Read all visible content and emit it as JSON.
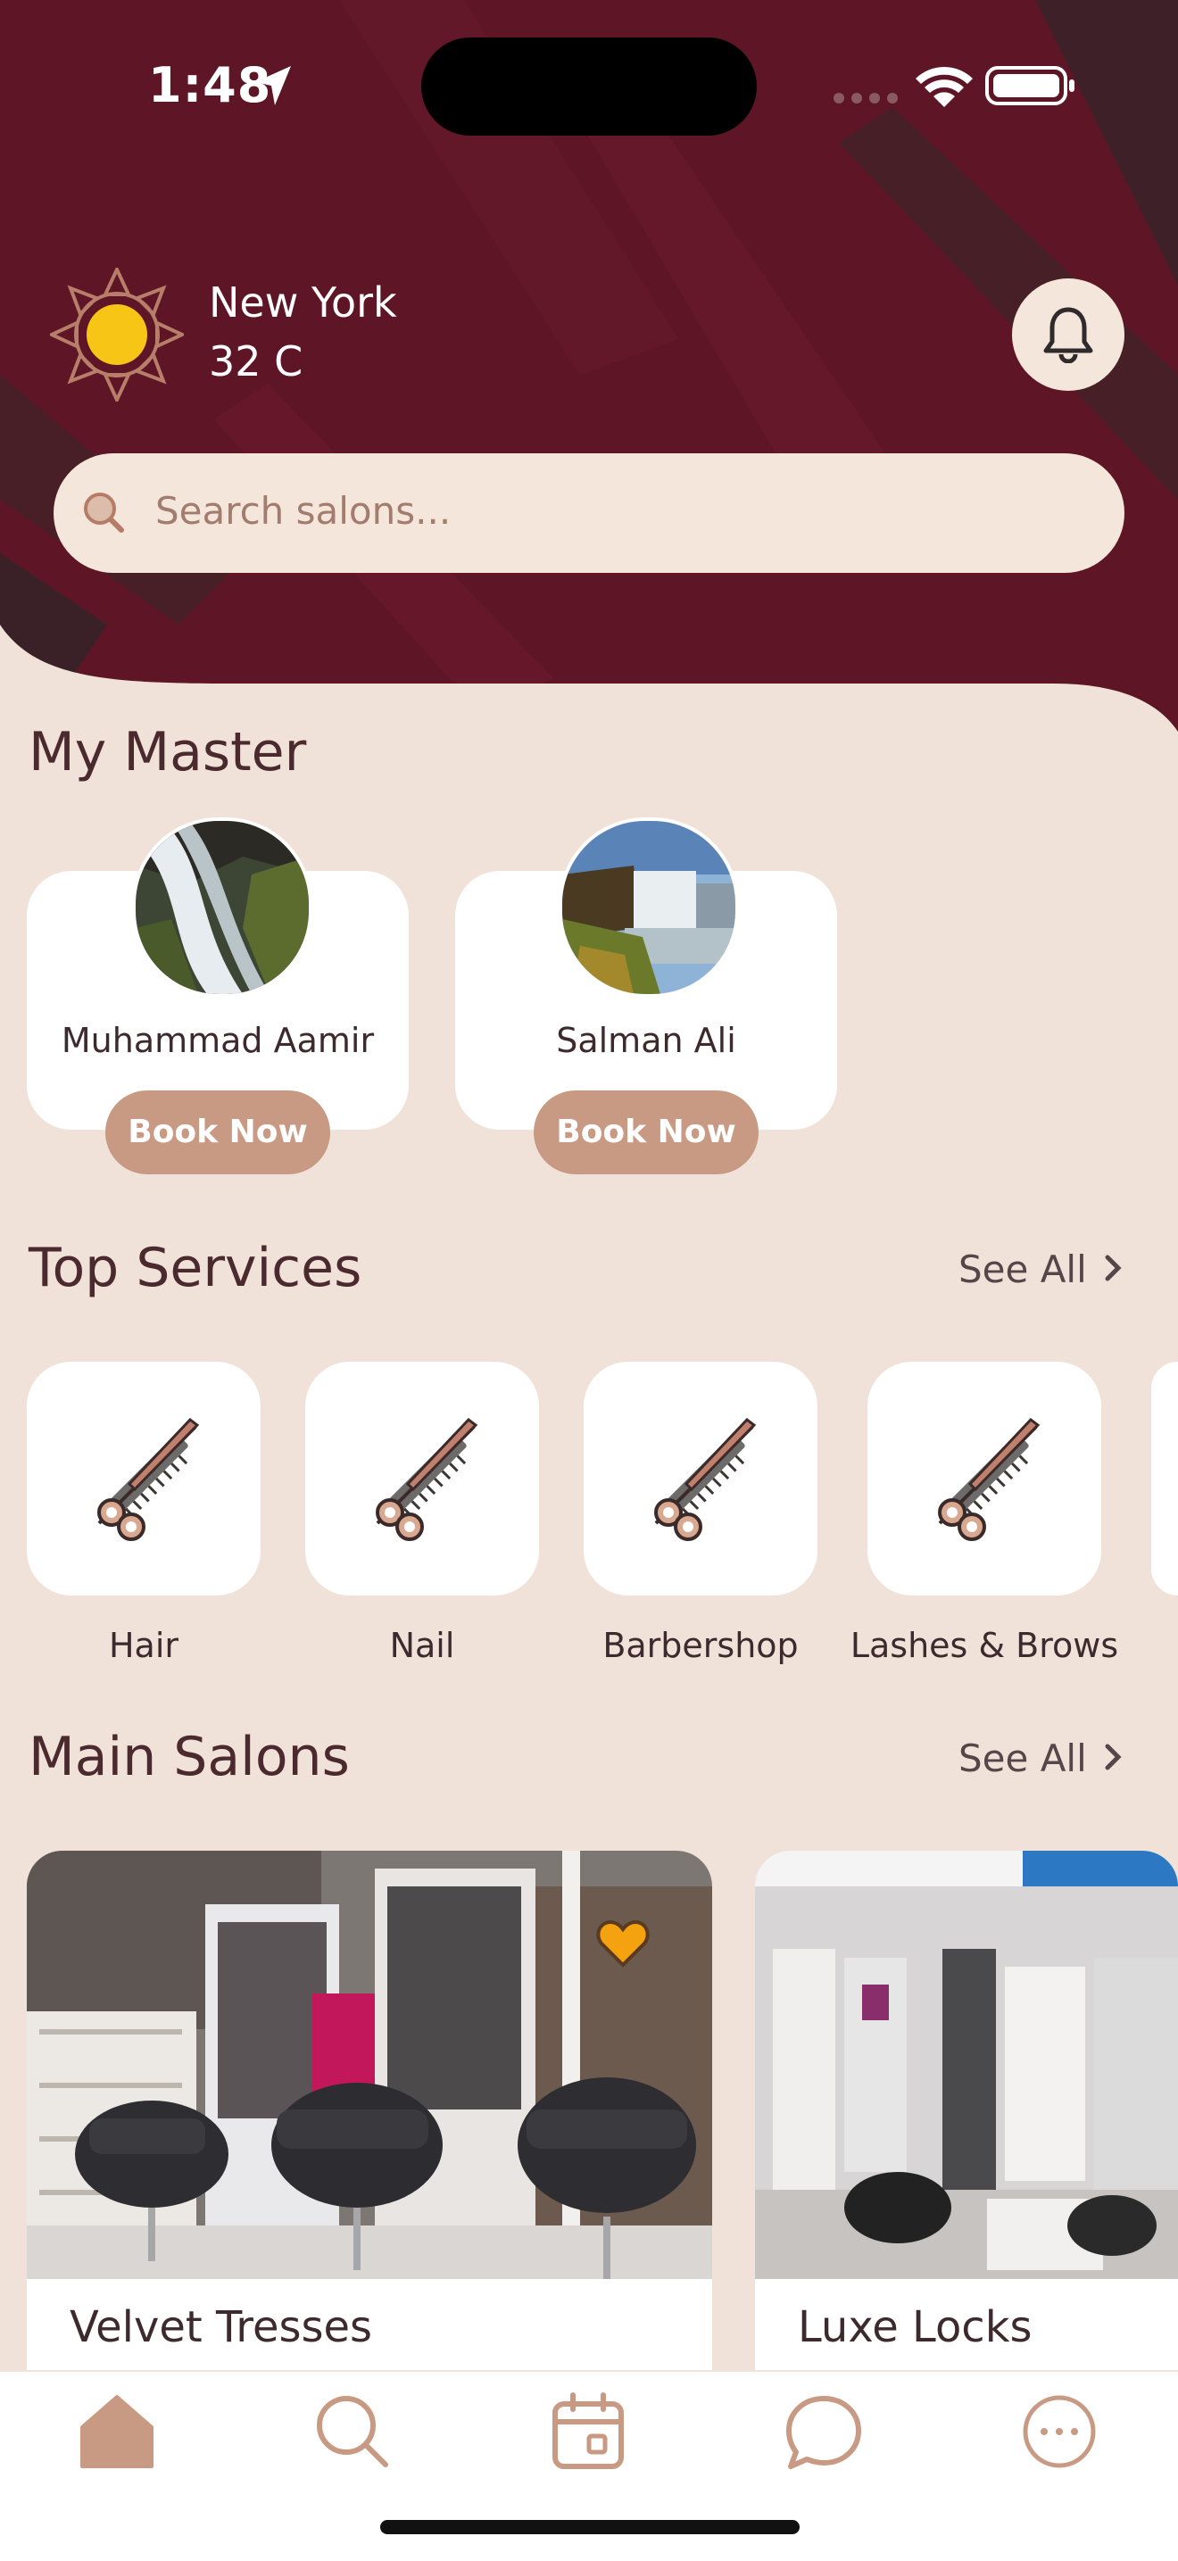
{
  "status_bar": {
    "time": "1:48"
  },
  "weather": {
    "city": "New York",
    "temperature": "32 C",
    "icon": "sun-icon"
  },
  "header": {
    "notification_icon": "bell-icon"
  },
  "search": {
    "placeholder": "Search salons..."
  },
  "masters": {
    "title": "My Master",
    "items": [
      {
        "name": "Muhammad Aamir",
        "button": "Book Now"
      },
      {
        "name": "Salman Ali",
        "button": "Book Now"
      }
    ]
  },
  "services": {
    "title": "Top Services",
    "see_all": "See All",
    "items": [
      {
        "label": "Hair",
        "icon": "scissors-comb-icon"
      },
      {
        "label": "Nail",
        "icon": "scissors-comb-icon"
      },
      {
        "label": "Barbershop",
        "icon": "scissors-comb-icon"
      },
      {
        "label": "Lashes & Brows",
        "icon": "scissors-comb-icon"
      }
    ]
  },
  "salons": {
    "title": "Main Salons",
    "see_all": "See All",
    "items": [
      {
        "name": "Velvet Tresses",
        "favorite": true
      },
      {
        "name": "Luxe Locks",
        "favorite": false
      }
    ]
  },
  "bottom_nav": {
    "items": [
      {
        "icon": "home-icon",
        "active": true
      },
      {
        "icon": "search-icon",
        "active": false
      },
      {
        "icon": "calendar-icon",
        "active": false
      },
      {
        "icon": "chat-icon",
        "active": false
      },
      {
        "icon": "more-icon",
        "active": false
      }
    ]
  },
  "colors": {
    "header_bg": "#5e1626",
    "page_bg": "#f0e2d8",
    "accent": "#c99a83",
    "favorite": "#f4a20f",
    "text_dark": "#4a2a2e"
  }
}
